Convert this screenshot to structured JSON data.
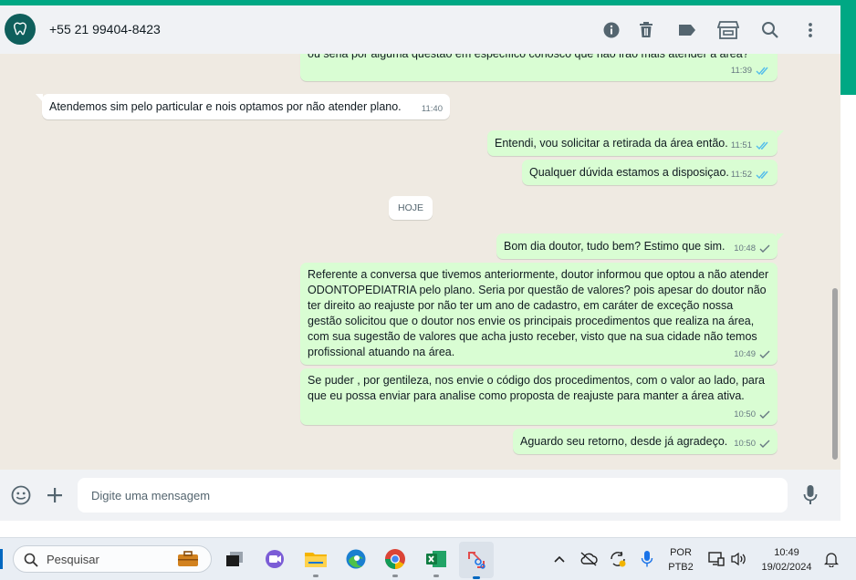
{
  "header": {
    "contact_name": "+55 21 99404-8423",
    "icons": [
      "info-icon",
      "trash-icon",
      "label-icon",
      "store-icon",
      "search-icon",
      "more-vertical-icon"
    ]
  },
  "messages": [
    {
      "direction": "out",
      "text": "ou seria por alguma questão em específico conosco que não irão mais atender a área?",
      "time": "11:39",
      "status": "read"
    },
    {
      "direction": "in",
      "text": "Atendemos sim pelo particular e nois  optamos por não  atender plano.",
      "time": "11:40"
    },
    {
      "direction": "out",
      "text": "Entendi, vou solicitar a retirada da área então.",
      "time": "11:51",
      "status": "read"
    },
    {
      "direction": "out",
      "text": "Qualquer dúvida estamos a disposiçao.",
      "time": "11:52",
      "status": "read"
    },
    {
      "direction": "out",
      "text": "Bom dia doutor, tudo bem? Estimo que sim.",
      "time": "10:48",
      "status": "sent"
    },
    {
      "direction": "out",
      "text": "Referente a conversa que tivemos anteriormente, doutor informou que optou a não atender ODONTOPEDIATRIA pelo plano. Seria por questão de valores? pois apesar do doutor não ter direito ao reajuste por não ter um ano de cadastro, em caráter de exceção nossa gestão solicitou que o doutor nos envie os principais procedimentos que realiza na área, com sua sugestão de valores que acha justo receber, visto que na sua cidade não temos profissional atuando na área.",
      "time": "10:49",
      "status": "sent"
    },
    {
      "direction": "out",
      "text": "Se puder , por gentileza, nos envie o código dos procedimentos, com o valor ao lado, para que eu possa enviar para analise como proposta de reajuste para manter a área ativa.",
      "time": "10:50",
      "status": "sent"
    },
    {
      "direction": "out",
      "text": "Aguardo seu retorno, desde já agradeço.",
      "time": "10:50",
      "status": "sent"
    }
  ],
  "day_chip": "HOJE",
  "composer": {
    "placeholder": "Digite uma mensagem"
  },
  "taskbar": {
    "search_label": "Pesquisar",
    "apps": [
      "briefcase-icon",
      "task-view-icon",
      "meet-icon",
      "file-explorer-icon",
      "edge-icon",
      "chrome-icon",
      "excel-icon",
      "snipping-tool-icon"
    ],
    "lang_top": "POR",
    "lang_bottom": "PTB2",
    "time": "10:49",
    "date": "19/02/2024"
  },
  "colors": {
    "accent": "#00a884",
    "outgoing": "#d9fdd3",
    "incoming": "#ffffff",
    "chat_bg": "#efeae2",
    "read_ticks": "#53bdeb"
  }
}
